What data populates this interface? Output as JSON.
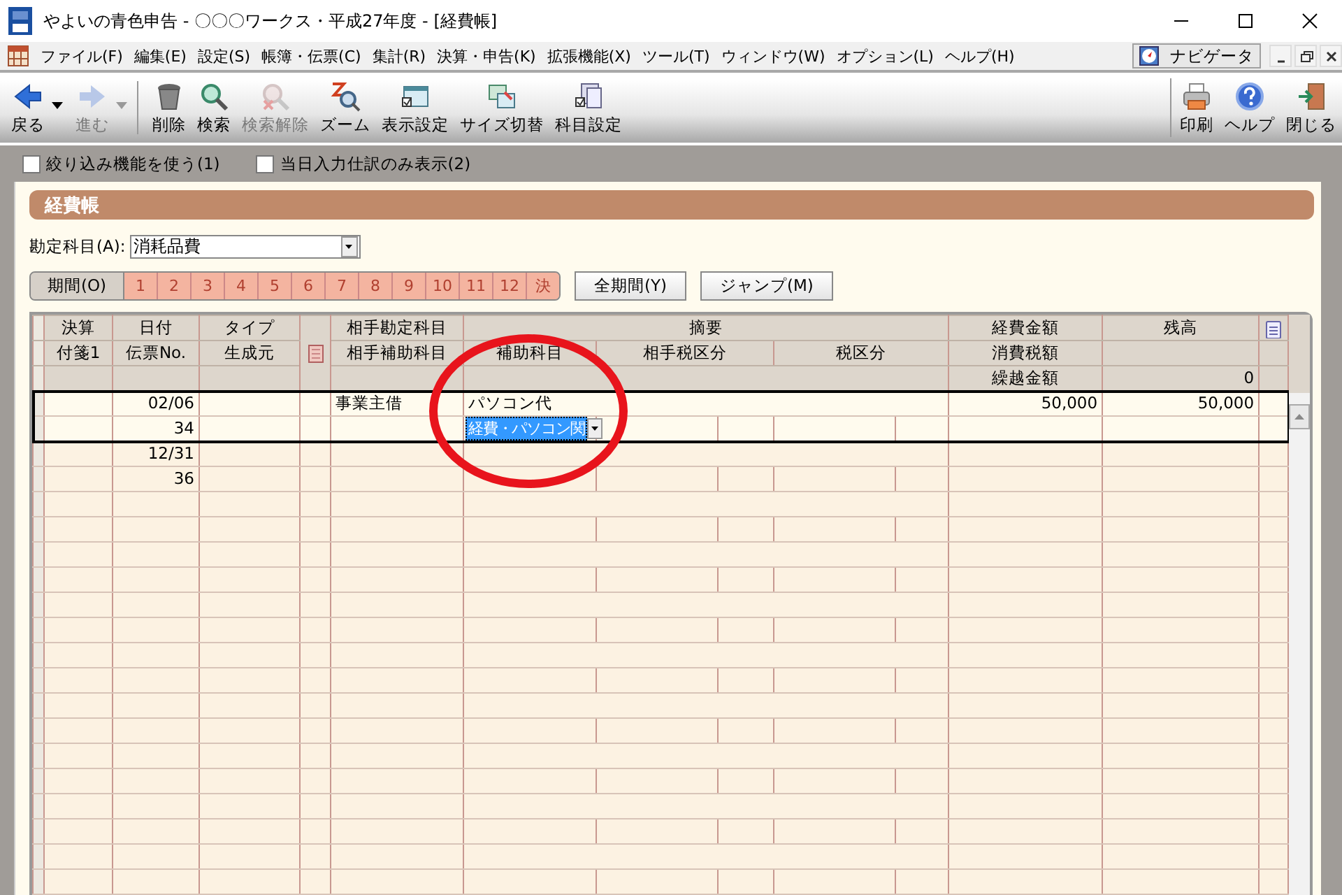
{
  "window": {
    "title": "やよいの青色申告 - 〇〇〇ワークス・平成27年度 - [経費帳]"
  },
  "menu": [
    "ファイル(F)",
    "編集(E)",
    "設定(S)",
    "帳簿・伝票(C)",
    "集計(R)",
    "決算・申告(K)",
    "拡張機能(X)",
    "ツール(T)",
    "ウィンドウ(W)",
    "オプション(L)",
    "ヘルプ(H)"
  ],
  "navigator": {
    "label": "ナビゲータ"
  },
  "toolbar": {
    "groups": [
      [
        {
          "label": "戻る",
          "disabled": false,
          "dropdown": true
        },
        {
          "label": "進む",
          "disabled": true,
          "dropdown": true
        }
      ],
      [
        {
          "label": "削除",
          "disabled": false,
          "dropdown": false
        },
        {
          "label": "検索",
          "disabled": false,
          "dropdown": false
        },
        {
          "label": "検索解除",
          "disabled": true,
          "dropdown": false
        },
        {
          "label": "ズーム",
          "disabled": false,
          "dropdown": false
        },
        {
          "label": "表示設定",
          "disabled": false,
          "dropdown": false
        },
        {
          "label": "サイズ切替",
          "disabled": false,
          "dropdown": false
        },
        {
          "label": "科目設定",
          "disabled": false,
          "dropdown": false
        }
      ]
    ],
    "right": [
      {
        "label": "印刷",
        "disabled": false,
        "dropdown": false
      },
      {
        "label": "ヘルプ",
        "disabled": false,
        "dropdown": false
      },
      {
        "label": "閉じる",
        "disabled": false,
        "dropdown": false
      }
    ]
  },
  "filters": [
    {
      "label": "絞り込み機能を使う(1)",
      "checked": false
    },
    {
      "label": "当日入力仕訳のみ表示(2)",
      "checked": false
    }
  ],
  "section": {
    "title": "経費帳"
  },
  "account": {
    "label": "勘定科目(A):",
    "value": "消耗品費"
  },
  "period": {
    "label": "期間(O)",
    "months": [
      "1",
      "2",
      "3",
      "4",
      "5",
      "6",
      "7",
      "8",
      "9",
      "10",
      "11",
      "12",
      "決"
    ]
  },
  "buttons": [
    "全期間(Y)",
    "ジャンプ(M)"
  ],
  "table": {
    "header": {
      "settle": "決算",
      "date": "日付",
      "type": "タイプ",
      "account": "相手勘定科目",
      "summary": "摘要",
      "amount": "経費金額",
      "balance": "残高",
      "tag": "付箋1",
      "slip_no": "伝票No.",
      "source": "生成元",
      "sub_account": "相手補助科目",
      "summary_sub": "補助科目",
      "counter_tax": "相手税区分",
      "tax": "税区分",
      "tax_amount": "消費税額",
      "carry_label": "繰越金額",
      "carry_balance": "0"
    },
    "records": [
      {
        "date": "02/06",
        "slip_no": "34",
        "account": "事業主借",
        "summary": "パソコン代",
        "summary_sub": "経費・パソコン関",
        "amount": "50,000",
        "balance": "50,000",
        "selected": true
      },
      {
        "date": "12/31",
        "slip_no": "36",
        "selected": false
      }
    ]
  },
  "annotation": {
    "kind": "ellipse",
    "color": "#e8141c"
  }
}
